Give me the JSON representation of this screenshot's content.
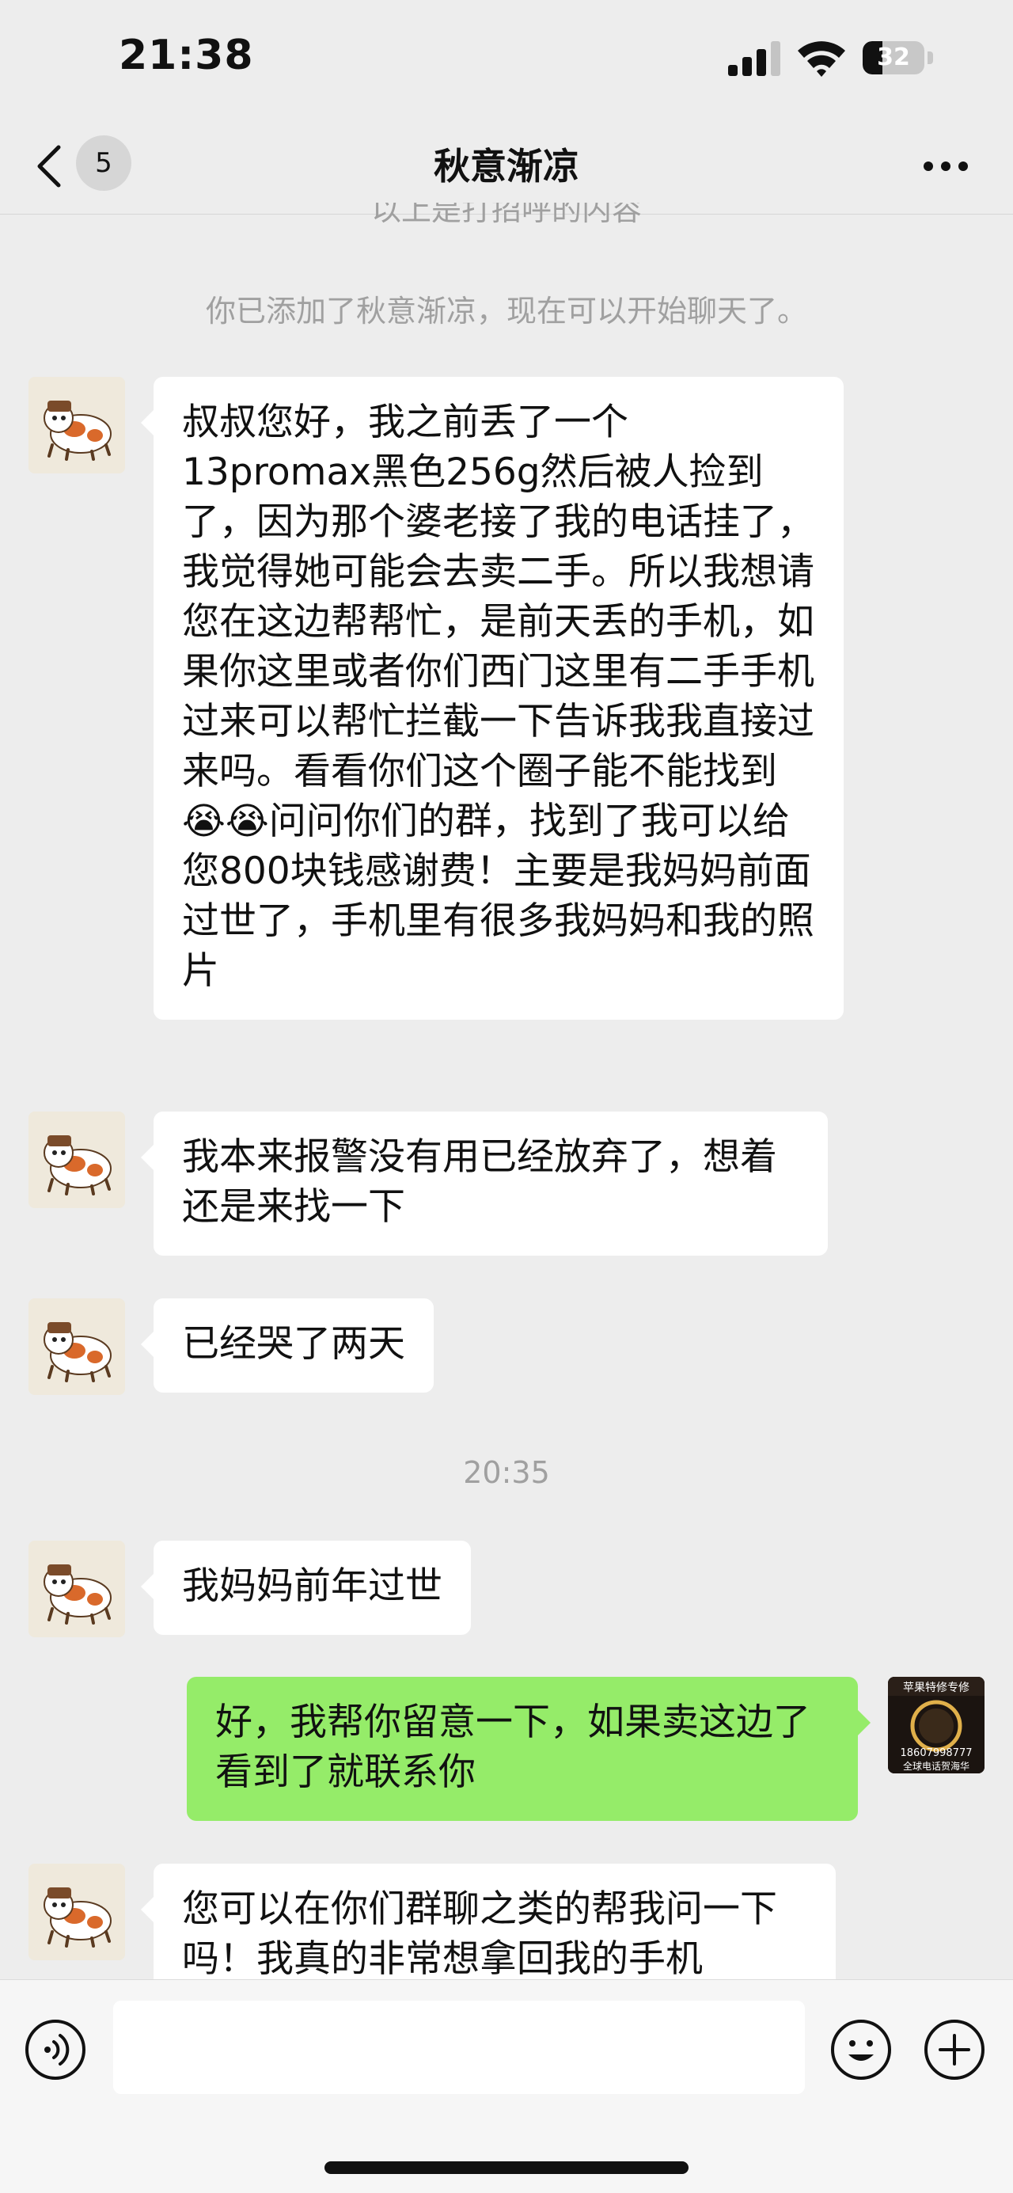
{
  "status_bar": {
    "time": "21:38",
    "battery": "32",
    "battery_level": 0.32
  },
  "header": {
    "unread_count": "5",
    "title": "秋意渐凉"
  },
  "chat": {
    "system_top": "以上是打招呼的内容",
    "system_added": "你已添加了秋意渐凉，现在可以开始聊天了。",
    "messages": [
      {
        "text": "叔叔您好，我之前丢了一个13promax黑色256g然后被人捡到了，因为那个婆老接了我的电话挂了，我觉得她可能会去卖二手。所以我想请您在这边帮帮忙，是前天丢的手机，如果你这里或者你们西门这里有二手手机过来可以帮忙拦截一下告诉我我直接过来吗。看看你们这个圈子能不能找到😭😭问问你们的群，找到了我可以给您800块钱感谢费！主要是我妈妈前面过世了，手机里有很多我妈妈和我的照片"
      },
      {
        "text": "我本来报警没有用已经放弃了，想着还是来找一下"
      },
      {
        "text": "已经哭了两天"
      },
      {
        "text": "我妈妈前年过世"
      },
      {
        "text": "好，我帮你留意一下，如果卖这边了看到了就联系你"
      },
      {
        "text": "您可以在你们群聊之类的帮我问一下吗！我真的非常想拿回我的手机"
      }
    ],
    "timestamp": "20:35",
    "my_avatar_text": {
      "line1": "苹果特修专修",
      "line2": "18607998777",
      "line3": "全球电话贺海华"
    }
  },
  "input": {
    "value": ""
  },
  "colors": {
    "background": "#ededed",
    "sent_bubble": "#95ec69",
    "received_bubble": "#ffffff",
    "system_text": "#a0a0a0"
  }
}
